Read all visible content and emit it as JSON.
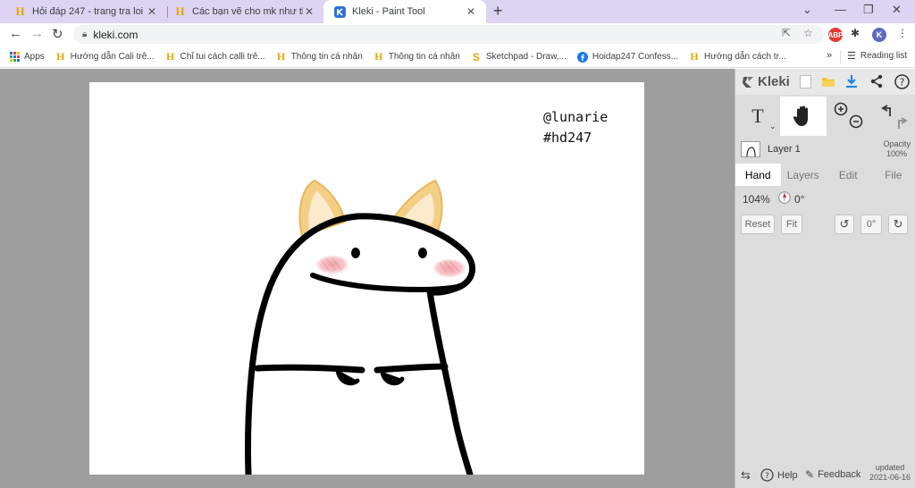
{
  "tabs": [
    {
      "title": "Hỏi đáp 247 - trang tra loi",
      "favicon": "hoidap-h-icon",
      "active": false
    },
    {
      "title": "Các bạn vẽ cho mk như tkế này n",
      "favicon": "hoidap-h-icon",
      "active": false
    },
    {
      "title": "Kleki - Paint Tool",
      "favicon": "kleki-icon",
      "active": true
    }
  ],
  "address": {
    "url": "kleki.com"
  },
  "bookmarks": [
    {
      "label": "Apps",
      "icon": "apps-grid-icon"
    },
    {
      "label": "Hướng dẫn Cali trê...",
      "icon": "hoidap-h-icon"
    },
    {
      "label": "Chỉ tui cách calli trê...",
      "icon": "hoidap-h-icon"
    },
    {
      "label": "Thông tin cá nhân",
      "icon": "hoidap-h-icon"
    },
    {
      "label": "Thông tin cá nhân",
      "icon": "hoidap-h-icon"
    },
    {
      "label": "Sketchpad - Draw,...",
      "icon": "sketchpad-icon"
    },
    {
      "label": "Hoidap247 Confess...",
      "icon": "facebook-icon"
    },
    {
      "label": "Hướng dẫn cách tr...",
      "icon": "hoidap-h-icon"
    }
  ],
  "bookmarks_more": "»",
  "reading_list": "Reading list",
  "profile_initial": "K",
  "abp_label": "ABP",
  "drawing": {
    "line1": "@lunarie",
    "line2": "#hd247"
  },
  "kleki": {
    "logo": "Kleki",
    "layer_name": "Layer 1",
    "opacity_label": "Opacity",
    "opacity_value": "100%",
    "tabs": [
      "Hand",
      "Layers",
      "Edit",
      "File"
    ],
    "active_tab": "Hand",
    "zoom": "104%",
    "rotation": "0°",
    "reset_label": "Reset",
    "fit_label": "Fit",
    "rot_reset_label": "0°",
    "help_label": "Help",
    "feedback_label": "Feedback",
    "updated_label": "updated",
    "updated_date": "2021-06-16"
  },
  "colors": {
    "tabstrip": "#ddd3f2",
    "workspace": "#9e9e9e",
    "panel": "#dcdcdc",
    "accent_download": "#1e88e5"
  }
}
